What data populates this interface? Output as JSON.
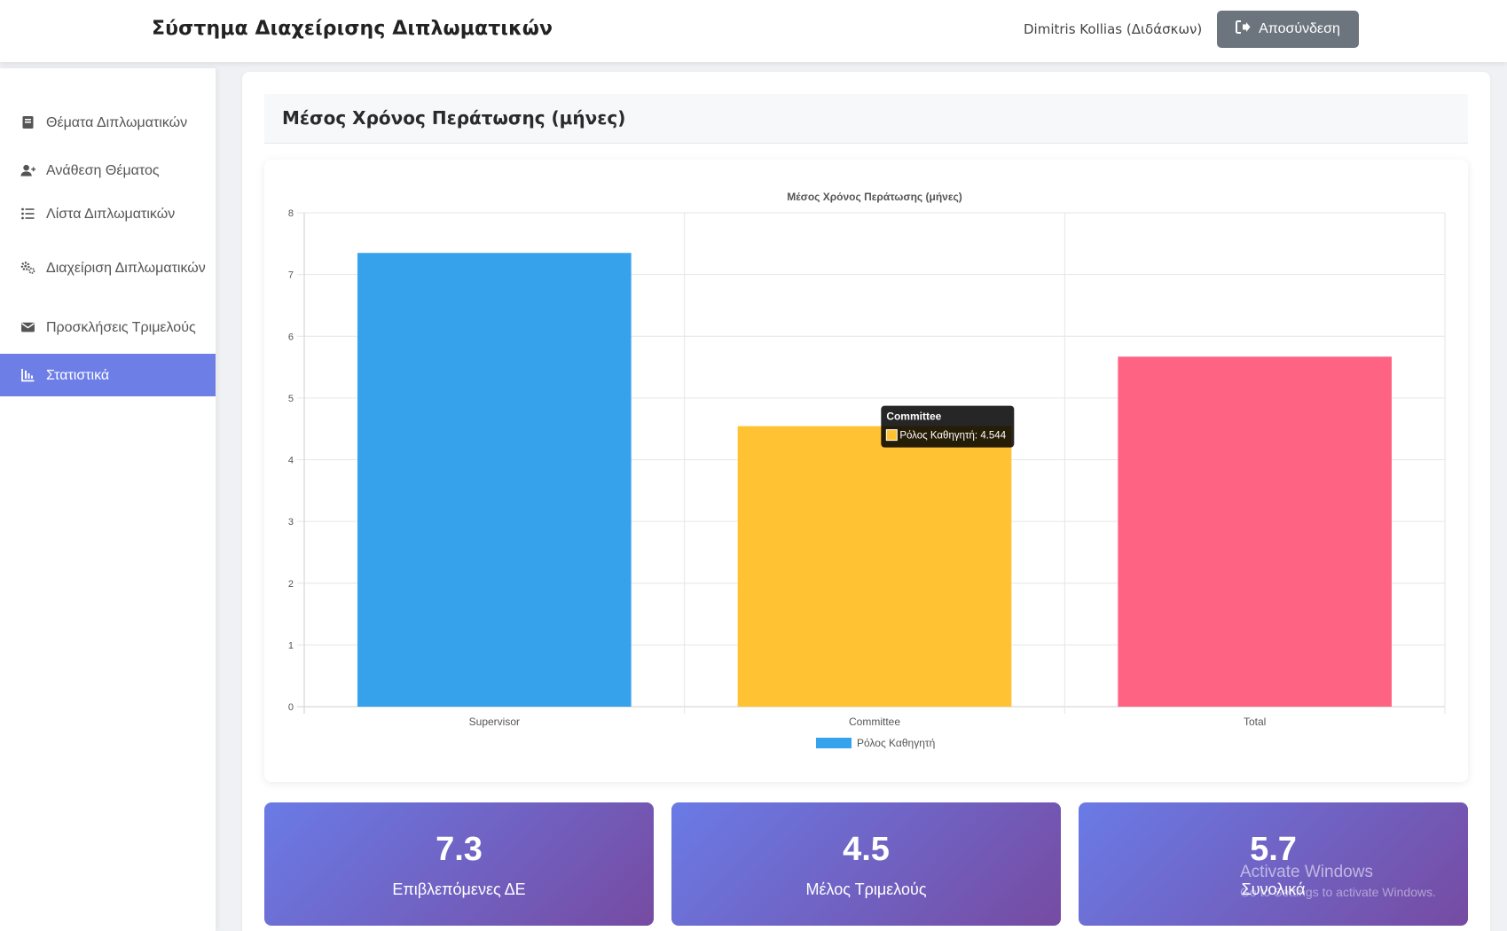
{
  "header": {
    "app_title": "Σύστημα Διαχείρισης Διπλωματικών",
    "user": "Dimitris Kollias (Διδάσκων)",
    "logout_label": "Αποσύνδεση"
  },
  "sidebar": {
    "items": [
      {
        "label": "Θέματα Διπλωματικών",
        "icon": "book-icon"
      },
      {
        "label": "Ανάθεση Θέματος",
        "icon": "user-plus-icon"
      },
      {
        "label": "Λίστα Διπλωματικών",
        "icon": "list-icon"
      },
      {
        "label": "Διαχείριση Διπλωματικών",
        "icon": "gears-icon"
      },
      {
        "label": "Προσκλήσεις Τριμελούς",
        "icon": "envelope-icon"
      },
      {
        "label": "Στατιστικά",
        "icon": "chart-icon",
        "active": true
      }
    ]
  },
  "main": {
    "section_title": "Μέσος Χρόνος Περάτωσης (μήνες)"
  },
  "chart_data": {
    "type": "bar",
    "title": "Μέσος Χρόνος Περάτωσης (μήνες)",
    "categories": [
      "Supervisor",
      "Committee",
      "Total"
    ],
    "series": [
      {
        "name": "Ρόλος Καθηγητή",
        "values": [
          7.35,
          4.544,
          5.67
        ]
      }
    ],
    "bar_colors": [
      "#36a2eb",
      "#ffc233",
      "#ff6384"
    ],
    "ylim": [
      0,
      8
    ],
    "yticks": [
      0,
      1,
      2,
      3,
      4,
      5,
      6,
      7,
      8
    ],
    "grid": true,
    "legend_position": "bottom",
    "tooltip": {
      "title": "Committee",
      "text": "Ρόλος Καθηγητή: 4.544",
      "color": "#ffc233"
    }
  },
  "stats": [
    {
      "value": "7.3",
      "label": "Επιβλεπόμενες ΔΕ"
    },
    {
      "value": "4.5",
      "label": "Μέλος Τριμελούς"
    },
    {
      "value": "5.7",
      "label": "Συνολικά"
    }
  ],
  "watermark": {
    "title": "Activate Windows",
    "sub": "Go to Settings to activate Windows."
  },
  "colors": {
    "accent": "#6d7fe7",
    "logout_button": "#6c757d",
    "stat_gradient_start": "#6a7be6",
    "stat_gradient_end": "#764ba2"
  }
}
